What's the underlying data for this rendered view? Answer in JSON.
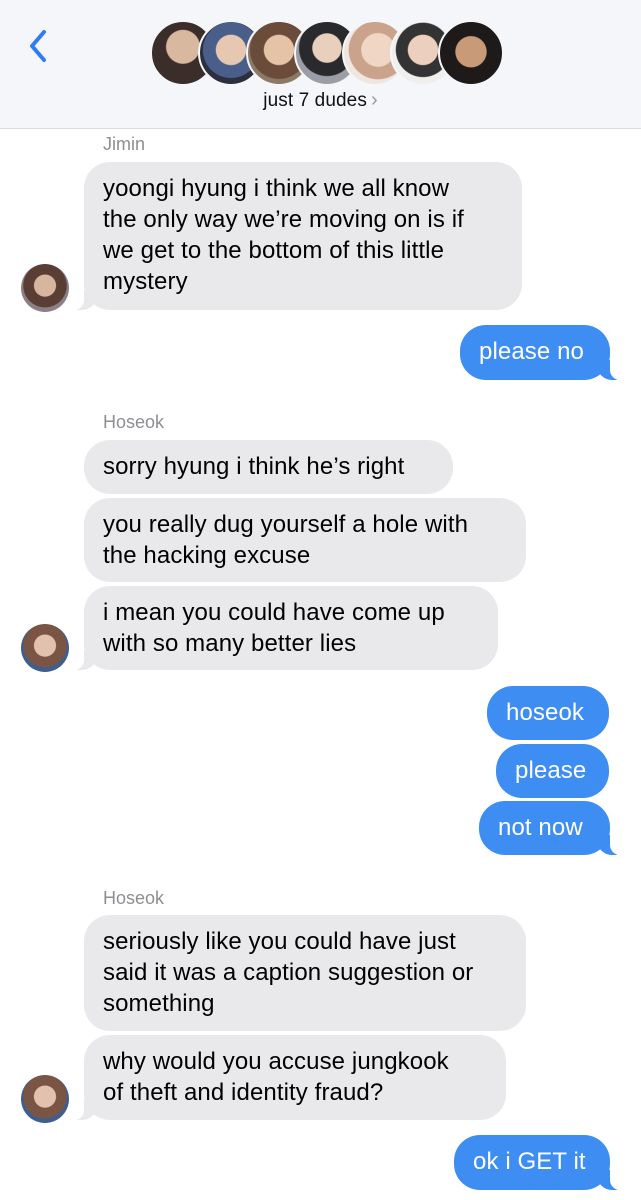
{
  "header": {
    "group_name": "just 7 dudes",
    "chevron": "›",
    "back_icon": "chevron-left-icon",
    "member_count": 7
  },
  "colors": {
    "incoming": "#e9e9eb",
    "outgoing": "#3e8df3",
    "accent": "#2f7cf6",
    "sender_label": "#8e8e93"
  },
  "thread": {
    "jimin_name": "Jimin",
    "m1": "yoongi hyung i think we all know\nthe only way we’re moving on is if\nwe get to the bottom of this little\nmystery",
    "m2": "please no",
    "hoseok_name_1": "Hoseok",
    "m3": "sorry hyung i think he’s right",
    "m4": "you really dug yourself a hole with\nthe hacking excuse",
    "m5": "i mean you could have come up\nwith so many better lies",
    "m6": "hoseok",
    "m7": "please",
    "m8": "not now",
    "hoseok_name_2": "Hoseok",
    "m9": "seriously like you could have just\nsaid it was a caption suggestion or\nsomething",
    "m10": "why would you accuse jungkook\nof theft and identity fraud?",
    "m11": "ok i GET it"
  }
}
